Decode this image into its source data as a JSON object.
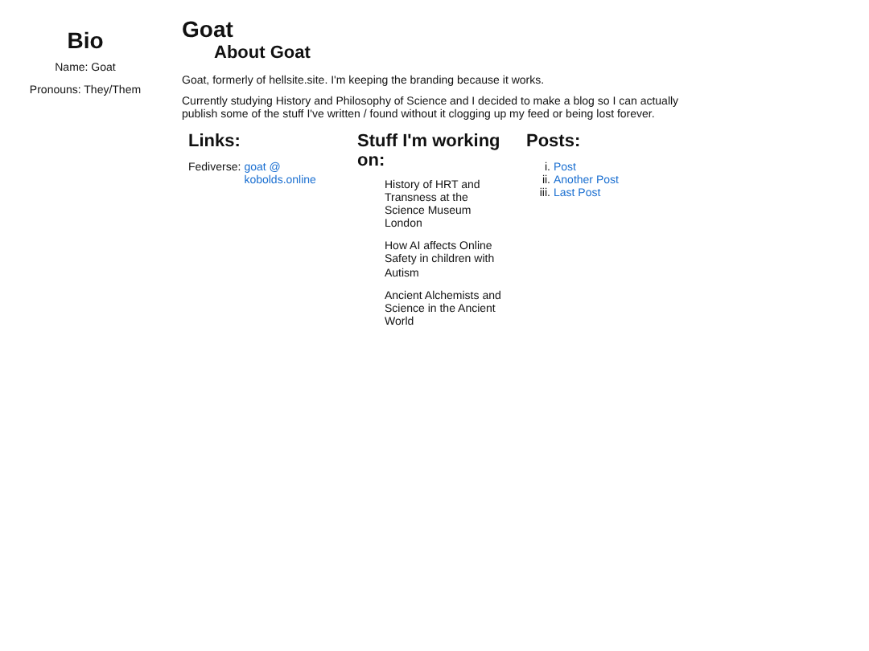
{
  "sidebar": {
    "title": "Bio",
    "items": [
      "Name: Goat",
      "Pronouns: They/Them"
    ]
  },
  "main": {
    "title": "Goat",
    "subtitle": "About Goat",
    "paragraphs": [
      "Goat, formerly of hellsite.site. I'm keeping the branding because it works.",
      "Currently studying History and Philosophy of Science and I decided to make a blog so I can actually publish some of the stuff I've written / found without it clogging up my feed or being lost forever."
    ]
  },
  "links": {
    "heading": "Links:",
    "label": "Fediverse:",
    "link": "goat @ kobolds.online"
  },
  "working": {
    "heading": "Stuff I'm working on:",
    "items": [
      "History of HRT and Transness at the Science Museum London",
      "How AI affects Online Safety in children with Autism",
      "Ancient Alchemists and Science in the Ancient World"
    ]
  },
  "posts": {
    "heading": "Posts:",
    "items": [
      {
        "marker": "i.",
        "title": "Post"
      },
      {
        "marker": "ii.",
        "title": "Another Post"
      },
      {
        "marker": "iii.",
        "title": "Last Post"
      }
    ]
  }
}
